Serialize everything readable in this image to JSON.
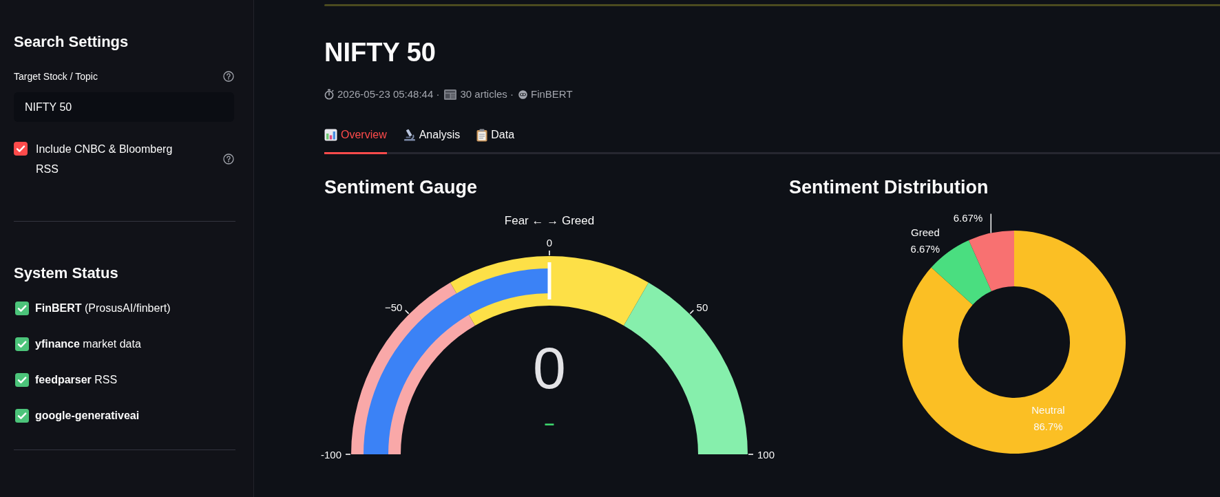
{
  "sidebar": {
    "search_heading": "Search Settings",
    "topic_field": {
      "label": "Target Stock / Topic",
      "value": "NIFTY 50"
    },
    "rss_checkbox": {
      "label": "Include CNBC & Bloomberg RSS",
      "checked": true
    },
    "status_heading": "System Status",
    "status_items": [
      {
        "name": "FinBERT",
        "detail": "(ProsusAI/finbert)",
        "available": true
      },
      {
        "name": "yfinance",
        "detail": "market data",
        "available": true
      },
      {
        "name": "feedparser",
        "detail": "RSS",
        "available": true
      },
      {
        "name": "google-generativeai",
        "available": true
      }
    ]
  },
  "header": {
    "title": "NIFTY 50",
    "meta": [
      "2026-05-23 05:48:44 ·",
      "30 articles ·",
      "FinBERT"
    ]
  },
  "tabs": [
    {
      "label": "Overview",
      "selected": true
    },
    {
      "label": "Analysis",
      "selected": false
    },
    {
      "label": "Data",
      "selected": false
    }
  ],
  "panels": {
    "gauge": {
      "heading": "Sentiment Gauge",
      "title": "Fear ← → Greed",
      "ticks": [
        "-100",
        "−50",
        "0",
        "50",
        "100"
      ],
      "steps": [
        {
          "color": "#f9a8a8"
        },
        {
          "color": "#fde047"
        },
        {
          "color": "#86efac"
        }
      ],
      "level": 0.5,
      "value": "0",
      "delta": "–"
    },
    "distribution": {
      "heading": "Sentiment Distribution",
      "chart_data": {
        "type": "donut",
        "categories": [
          "Neutral",
          "Greed",
          null
        ],
        "values": [
          86.7,
          6.67,
          6.67
        ],
        "colors": [
          "#fbbf24",
          "#4ade80",
          "#f87171"
        ],
        "value_labels": [
          "86.7%",
          "6.67%",
          "6.67%"
        ]
      }
    }
  }
}
